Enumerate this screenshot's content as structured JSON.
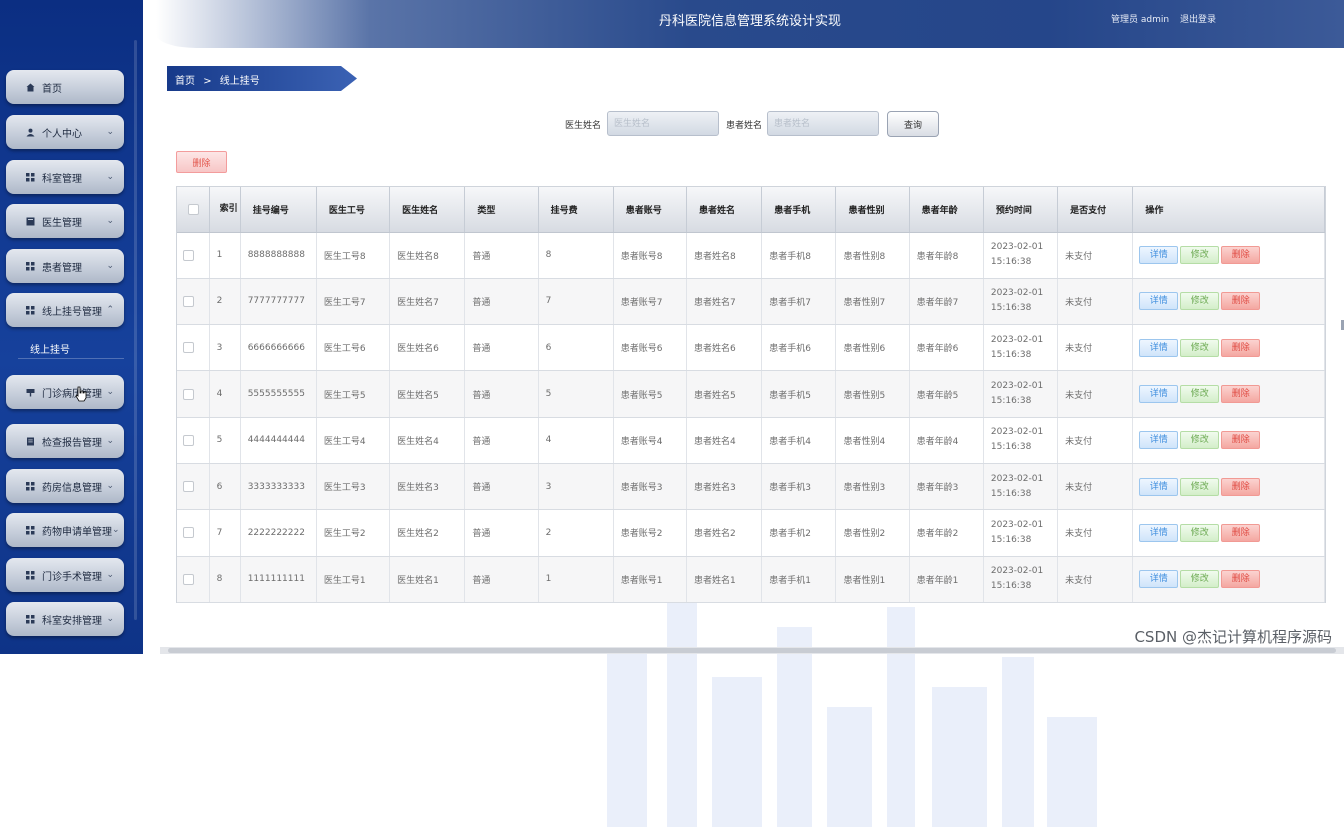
{
  "header": {
    "title": "丹科医院信息管理系统设计实现",
    "admin": "管理员 admin",
    "logout": "退出登录"
  },
  "sidebar": {
    "items": [
      {
        "label": "首页",
        "icon": "home-icon"
      },
      {
        "label": "个人中心",
        "icon": "user-icon"
      },
      {
        "label": "科室管理",
        "icon": "grid-icon"
      },
      {
        "label": "医生管理",
        "icon": "square-icon"
      },
      {
        "label": "患者管理",
        "icon": "grid-icon"
      },
      {
        "label": "线上挂号管理",
        "icon": "grid-icon"
      },
      {
        "label": "门诊病历管理",
        "icon": "flag-icon"
      },
      {
        "label": "检查报告管理",
        "icon": "doc-icon"
      },
      {
        "label": "药房信息管理",
        "icon": "grid-icon"
      },
      {
        "label": "药物申请单管理",
        "icon": "grid-icon"
      },
      {
        "label": "门诊手术管理",
        "icon": "grid-icon"
      },
      {
        "label": "科室安排管理",
        "icon": "grid-icon"
      }
    ],
    "sub_item": "线上挂号"
  },
  "breadcrumb": {
    "home": "首页",
    "separator": ">",
    "current": "线上挂号"
  },
  "search": {
    "doctor_label": "医生姓名",
    "doctor_placeholder": "医生姓名",
    "patient_label": "患者姓名",
    "patient_placeholder": "患者姓名",
    "query_button": "查询"
  },
  "toolbar": {
    "delete_label": "删除"
  },
  "table": {
    "columns": [
      "",
      "索引",
      "挂号编号",
      "医生工号",
      "医生姓名",
      "类型",
      "挂号费",
      "患者账号",
      "患者姓名",
      "患者手机",
      "患者性别",
      "患者年龄",
      "预约时间",
      "是否支付",
      "操作"
    ],
    "rows": [
      {
        "index": "1",
        "reg_no": "8888888888",
        "doc_no": "医生工号8",
        "doc_name": "医生姓名8",
        "type": "普通",
        "fee": "8",
        "acct": "患者账号8",
        "pname": "患者姓名8",
        "phone": "患者手机8",
        "gender": "患者性别8",
        "age": "患者年龄8",
        "time": "2023-02-01 15:16:38",
        "paid": "未支付"
      },
      {
        "index": "2",
        "reg_no": "7777777777",
        "doc_no": "医生工号7",
        "doc_name": "医生姓名7",
        "type": "普通",
        "fee": "7",
        "acct": "患者账号7",
        "pname": "患者姓名7",
        "phone": "患者手机7",
        "gender": "患者性别7",
        "age": "患者年龄7",
        "time": "2023-02-01 15:16:38",
        "paid": "未支付"
      },
      {
        "index": "3",
        "reg_no": "6666666666",
        "doc_no": "医生工号6",
        "doc_name": "医生姓名6",
        "type": "普通",
        "fee": "6",
        "acct": "患者账号6",
        "pname": "患者姓名6",
        "phone": "患者手机6",
        "gender": "患者性别6",
        "age": "患者年龄6",
        "time": "2023-02-01 15:16:38",
        "paid": "未支付"
      },
      {
        "index": "4",
        "reg_no": "5555555555",
        "doc_no": "医生工号5",
        "doc_name": "医生姓名5",
        "type": "普通",
        "fee": "5",
        "acct": "患者账号5",
        "pname": "患者姓名5",
        "phone": "患者手机5",
        "gender": "患者性别5",
        "age": "患者年龄5",
        "time": "2023-02-01 15:16:38",
        "paid": "未支付"
      },
      {
        "index": "5",
        "reg_no": "4444444444",
        "doc_no": "医生工号4",
        "doc_name": "医生姓名4",
        "type": "普通",
        "fee": "4",
        "acct": "患者账号4",
        "pname": "患者姓名4",
        "phone": "患者手机4",
        "gender": "患者性别4",
        "age": "患者年龄4",
        "time": "2023-02-01 15:16:38",
        "paid": "未支付"
      },
      {
        "index": "6",
        "reg_no": "3333333333",
        "doc_no": "医生工号3",
        "doc_name": "医生姓名3",
        "type": "普通",
        "fee": "3",
        "acct": "患者账号3",
        "pname": "患者姓名3",
        "phone": "患者手机3",
        "gender": "患者性别3",
        "age": "患者年龄3",
        "time": "2023-02-01 15:16:38",
        "paid": "未支付"
      },
      {
        "index": "7",
        "reg_no": "2222222222",
        "doc_no": "医生工号2",
        "doc_name": "医生姓名2",
        "type": "普通",
        "fee": "2",
        "acct": "患者账号2",
        "pname": "患者姓名2",
        "phone": "患者手机2",
        "gender": "患者性别2",
        "age": "患者年龄2",
        "time": "2023-02-01 15:16:38",
        "paid": "未支付"
      },
      {
        "index": "8",
        "reg_no": "1111111111",
        "doc_no": "医生工号1",
        "doc_name": "医生姓名1",
        "type": "普通",
        "fee": "1",
        "acct": "患者账号1",
        "pname": "患者姓名1",
        "phone": "患者手机1",
        "gender": "患者性别1",
        "age": "患者年龄1",
        "time": "2023-02-01 15:16:38",
        "paid": "未支付"
      }
    ],
    "actions": {
      "detail": "详情",
      "edit": "修改",
      "delete": "删除"
    }
  },
  "watermark": "CSDN @杰记计算机程序源码",
  "colors": {
    "sidebar": "#16419c",
    "header": "#294a8c",
    "breadcrumb": "#1f4699",
    "danger": "#e2554b",
    "info": "#3f8ede",
    "success": "#6caa52"
  }
}
